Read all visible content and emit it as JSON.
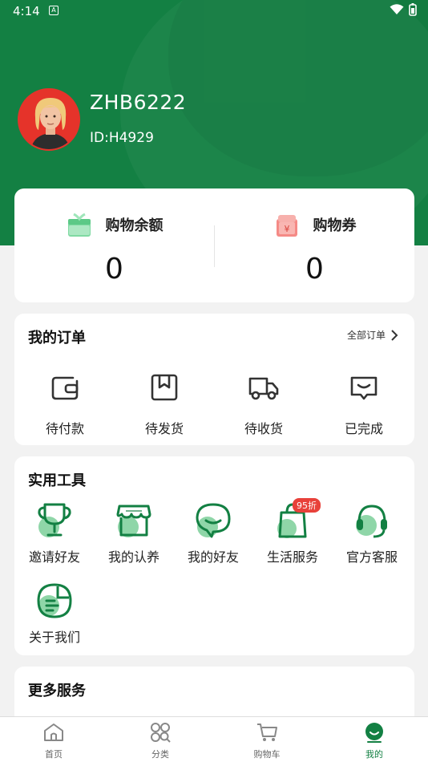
{
  "status_bar": {
    "time": "4:14",
    "notif_icon": "A"
  },
  "profile": {
    "username": "ZHB6222",
    "user_id": "ID:H4929",
    "avatar_icon": "avatar-person-icon"
  },
  "balance": {
    "shopping_balance": {
      "label": "购物余额",
      "value": "0",
      "icon": "gift-box-icon"
    },
    "coupons": {
      "label": "购物券",
      "value": "0",
      "icon": "coupon-bag-icon"
    }
  },
  "orders": {
    "title": "我的订单",
    "all_orders": "全部订单",
    "items": [
      {
        "label": "待付款",
        "icon": "wallet-icon"
      },
      {
        "label": "待发货",
        "icon": "package-icon"
      },
      {
        "label": "待收货",
        "icon": "truck-icon"
      },
      {
        "label": "已完成",
        "icon": "inbox-check-icon"
      }
    ]
  },
  "tools": {
    "title": "实用工具",
    "items": [
      {
        "label": "邀请好友",
        "icon": "trophy-icon"
      },
      {
        "label": "我的认养",
        "icon": "shop-icon"
      },
      {
        "label": "我的好友",
        "icon": "chat-bubble-icon"
      },
      {
        "label": "生活服务",
        "icon": "shopping-bag-icon",
        "badge": "95折"
      },
      {
        "label": "官方客服",
        "icon": "headset-icon"
      },
      {
        "label": "关于我们",
        "icon": "document-icon"
      }
    ]
  },
  "more_services": {
    "title": "更多服务"
  },
  "bottom_nav": {
    "items": [
      {
        "label": "首页",
        "icon": "home-icon"
      },
      {
        "label": "分类",
        "icon": "grid-search-icon"
      },
      {
        "label": "购物车",
        "icon": "cart-icon"
      },
      {
        "label": "我的",
        "icon": "profile-face-icon",
        "active": true
      }
    ]
  },
  "colors": {
    "brand_green": "#138043",
    "light_green": "#8fd6a8",
    "badge_red": "#e8413a"
  }
}
